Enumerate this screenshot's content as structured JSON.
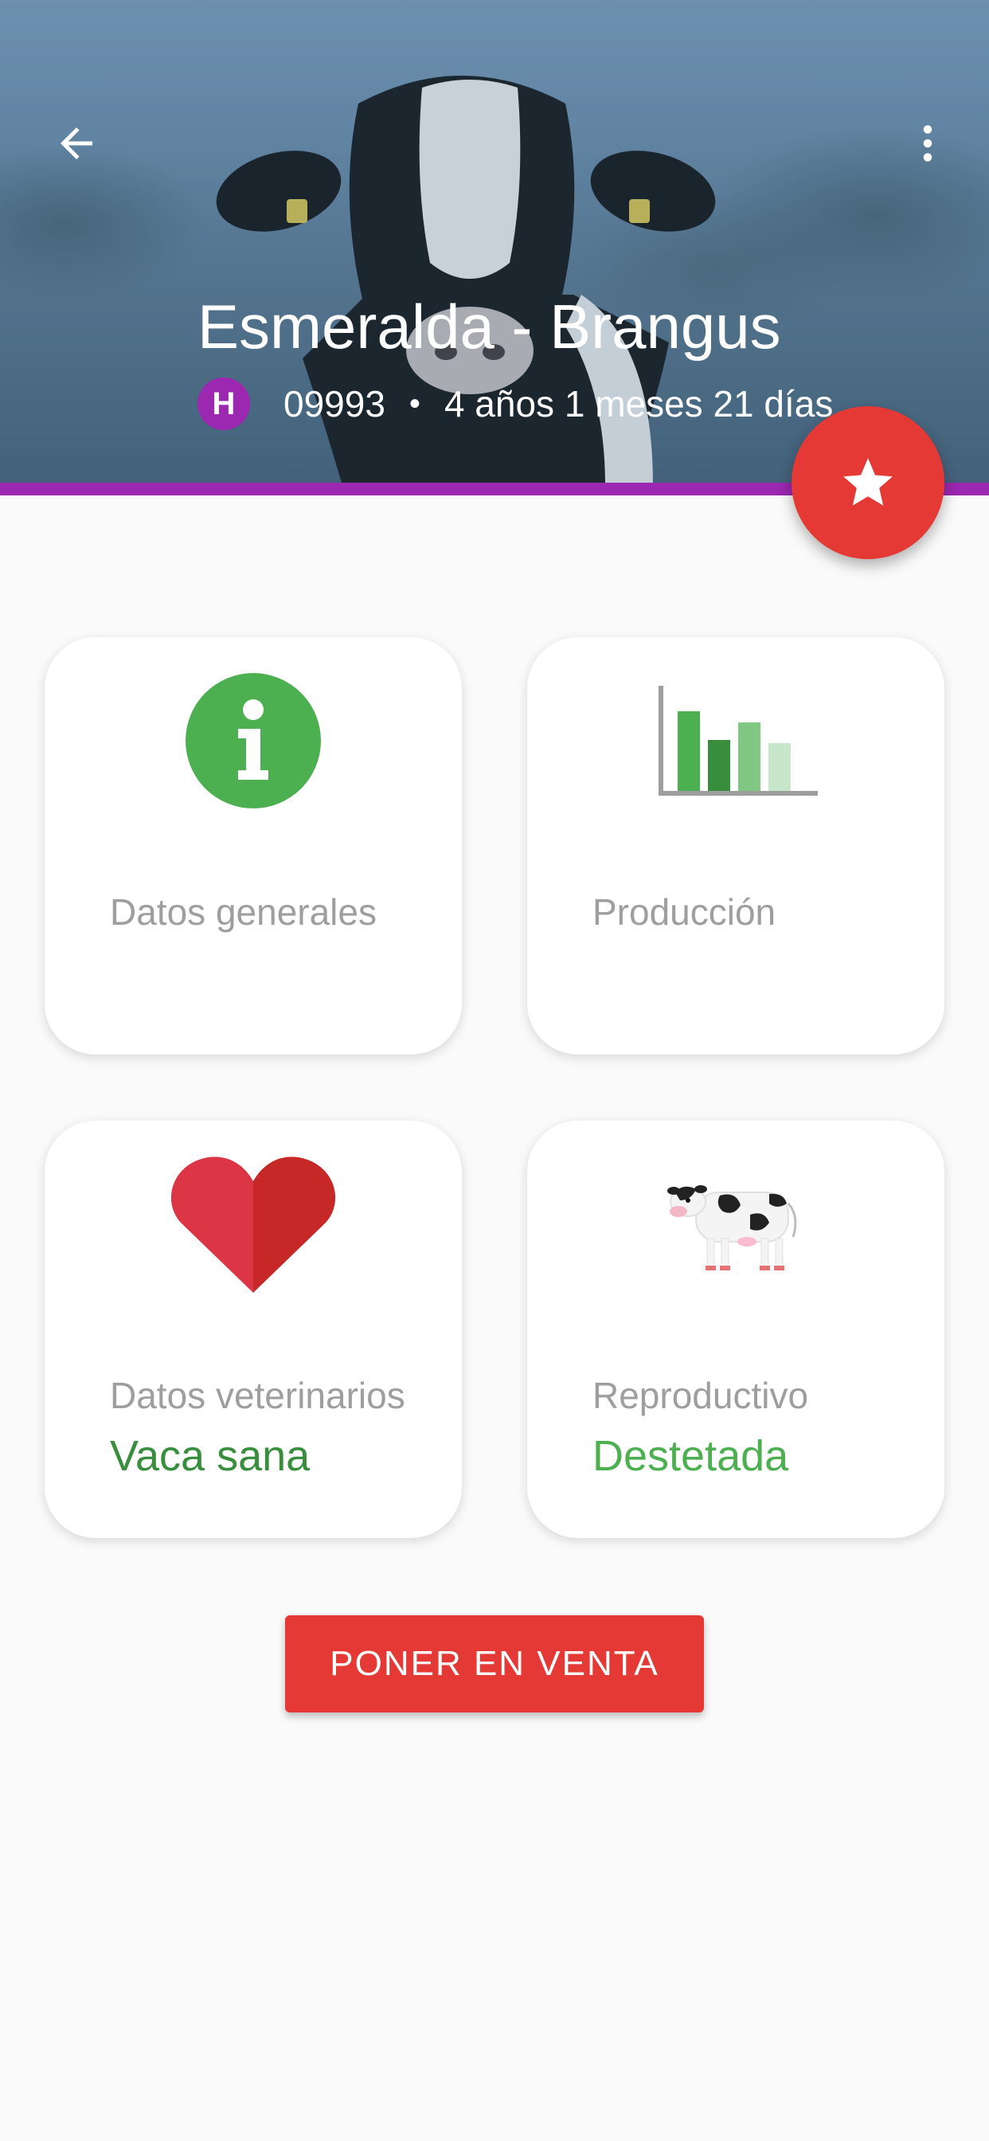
{
  "header": {
    "title": "Esmeralda - Brangus",
    "sex_badge": "H",
    "id_number": "09993",
    "separator": "•",
    "age": "4 años 1 meses 21 días"
  },
  "cards": [
    {
      "label": "Datos generales",
      "status": "",
      "icon": "info-icon"
    },
    {
      "label": "Producción",
      "status": "",
      "icon": "bar-chart-icon"
    },
    {
      "label": "Datos veterinarios",
      "status": "Vaca sana",
      "icon": "heart-icon"
    },
    {
      "label": "Reproductivo",
      "status": "Destetada",
      "icon": "cow-icon"
    }
  ],
  "actions": {
    "sell_label": "PONER EN VENTA"
  },
  "colors": {
    "accent_purple": "#9c27b0",
    "fab_red": "#e53935",
    "status_green_dark": "#388e3c",
    "status_green": "#4caf50"
  }
}
